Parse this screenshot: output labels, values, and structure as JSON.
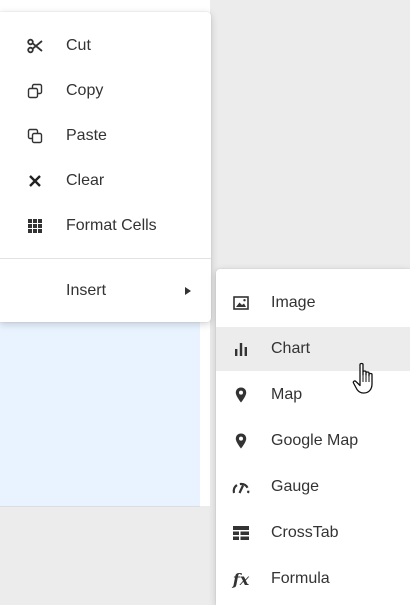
{
  "context_menu": {
    "items": [
      {
        "label": "Cut",
        "icon": "scissors-icon"
      },
      {
        "label": "Copy",
        "icon": "copy-icon"
      },
      {
        "label": "Paste",
        "icon": "paste-icon"
      },
      {
        "label": "Clear",
        "icon": "close-icon"
      },
      {
        "label": "Format Cells",
        "icon": "grid-icon"
      }
    ],
    "insert": {
      "label": "Insert",
      "icon": "submenu-arrow-icon"
    }
  },
  "insert_submenu": {
    "items": [
      {
        "label": "Image",
        "icon": "image-icon"
      },
      {
        "label": "Chart",
        "icon": "bar-chart-icon",
        "hovered": true
      },
      {
        "label": "Map",
        "icon": "map-pin-icon"
      },
      {
        "label": "Google Map",
        "icon": "map-pin-icon"
      },
      {
        "label": "Gauge",
        "icon": "gauge-icon"
      },
      {
        "label": "CrossTab",
        "icon": "crosstab-icon"
      },
      {
        "label": "Formula",
        "icon": "formula-icon"
      }
    ]
  },
  "colors": {
    "hover": "#ececec",
    "background": "#ececec",
    "selection": "#e8f3ff"
  }
}
